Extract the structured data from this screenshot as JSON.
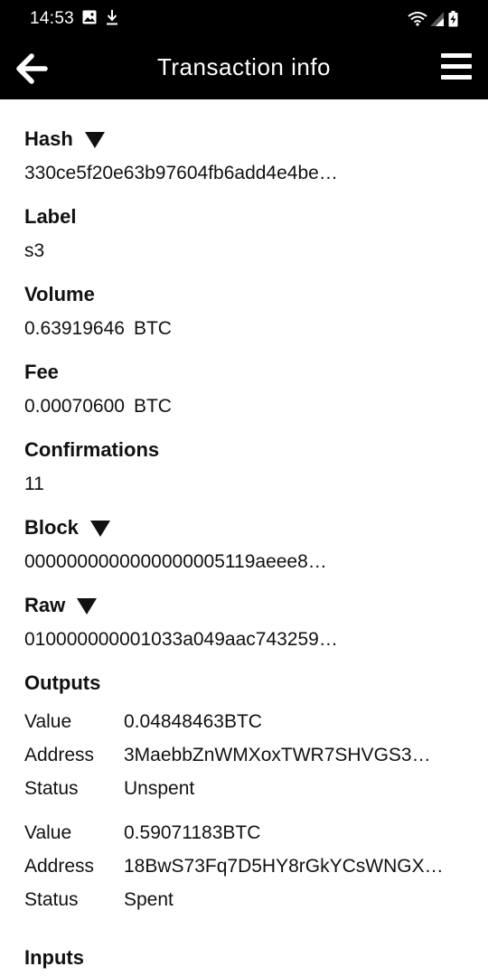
{
  "status_bar": {
    "time": "14:53"
  },
  "app_bar": {
    "title": "Transaction info"
  },
  "fields": {
    "hash": {
      "label": "Hash",
      "value": "330ce5f20e63b97604fb6add4e4be…"
    },
    "label": {
      "label": "Label",
      "value": "s3"
    },
    "volume": {
      "label": "Volume",
      "value": "0.63919646",
      "unit": "BTC"
    },
    "fee": {
      "label": "Fee",
      "value": "0.00070600",
      "unit": "BTC"
    },
    "confirmations": {
      "label": "Confirmations",
      "value": "11"
    },
    "block": {
      "label": "Block",
      "value": "0000000000000000005119aeee8…"
    },
    "raw": {
      "label": "Raw",
      "value": "010000000001033a049aac743259…"
    }
  },
  "outputs": {
    "label": "Outputs",
    "keys": {
      "value": "Value",
      "address": "Address",
      "status": "Status"
    },
    "items": [
      {
        "value": "0.04848463BTC",
        "address": "3MaebbZnWMXoxTWR7SHVGS3…",
        "status": "Unspent"
      },
      {
        "value": "0.59071183BTC",
        "address": "18BwS73Fq7D5HY8rGkYCsWNGX…",
        "status": "Spent"
      }
    ]
  },
  "inputs": {
    "label": "Inputs"
  },
  "icons": {
    "back": "arrow-back-icon",
    "menu": "hamburger-menu-icon",
    "expand": "triangle-down-icon"
  }
}
